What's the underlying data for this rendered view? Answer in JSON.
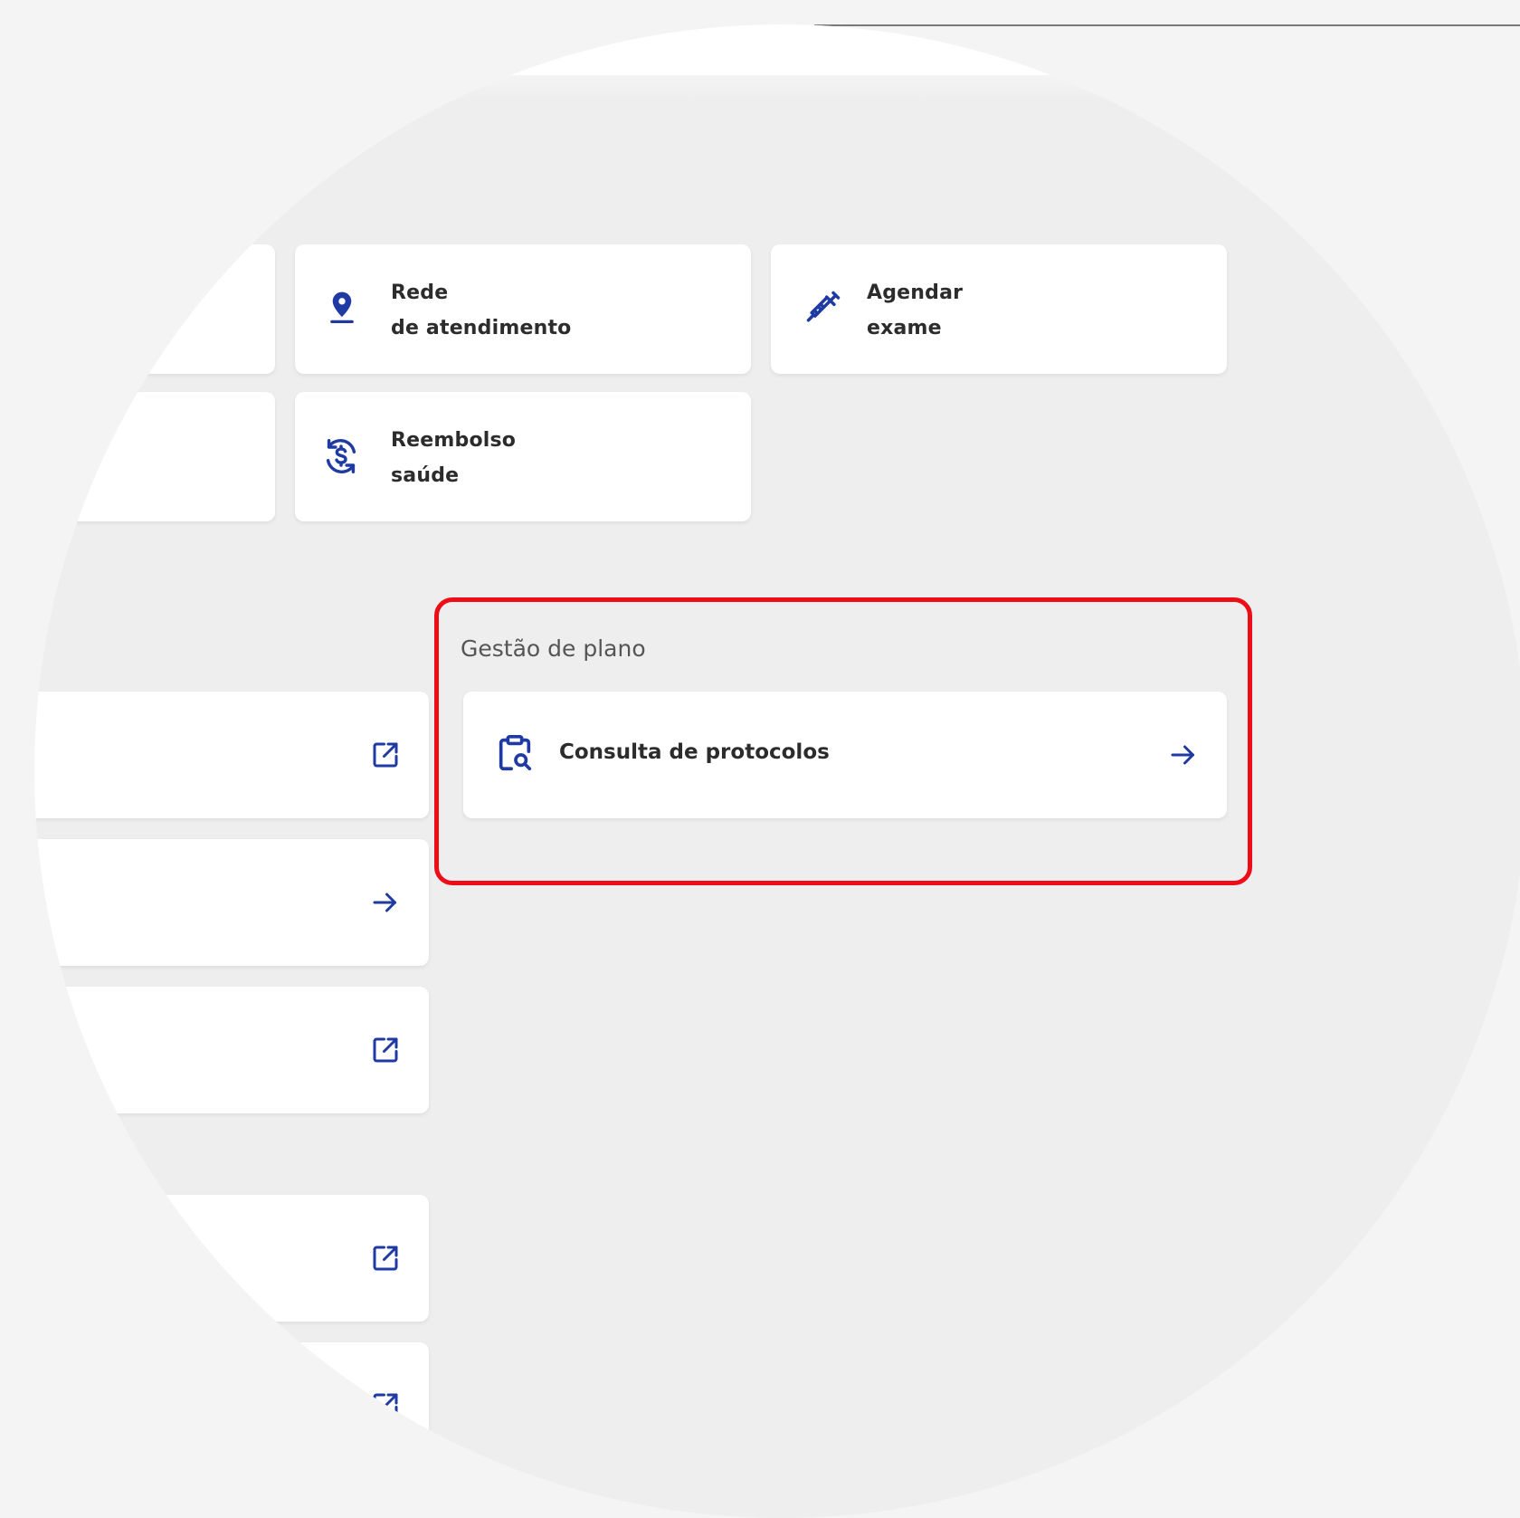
{
  "quick_actions": {
    "network": {
      "line1": "Rede",
      "line2": "de atendimento",
      "icon": "location-pin-icon"
    },
    "exam": {
      "line1": "Agendar",
      "line2": "exame",
      "icon": "syringe-icon"
    },
    "refund": {
      "line1": "Reembolso",
      "line2": "saúde",
      "icon": "refund-dollar-icon"
    }
  },
  "plan_management": {
    "title": "Gestão de plano",
    "items": [
      {
        "label": "Consulta de protocolos",
        "icon": "clipboard-search-icon",
        "trail_icon": "arrow-right-icon"
      }
    ]
  },
  "left_list": {
    "items": [
      {
        "trail_icon": "external-link-icon"
      },
      {
        "trail_icon": "arrow-right-icon"
      },
      {
        "trail_icon": "external-link-icon"
      },
      {
        "trail_icon": "external-link-icon"
      },
      {
        "trail_icon": "external-link-icon"
      }
    ]
  },
  "colors": {
    "accent": "#1f3aa3",
    "highlight": "#ee0c16",
    "panel_bg": "#eeeeee",
    "card_bg": "#ffffff"
  }
}
